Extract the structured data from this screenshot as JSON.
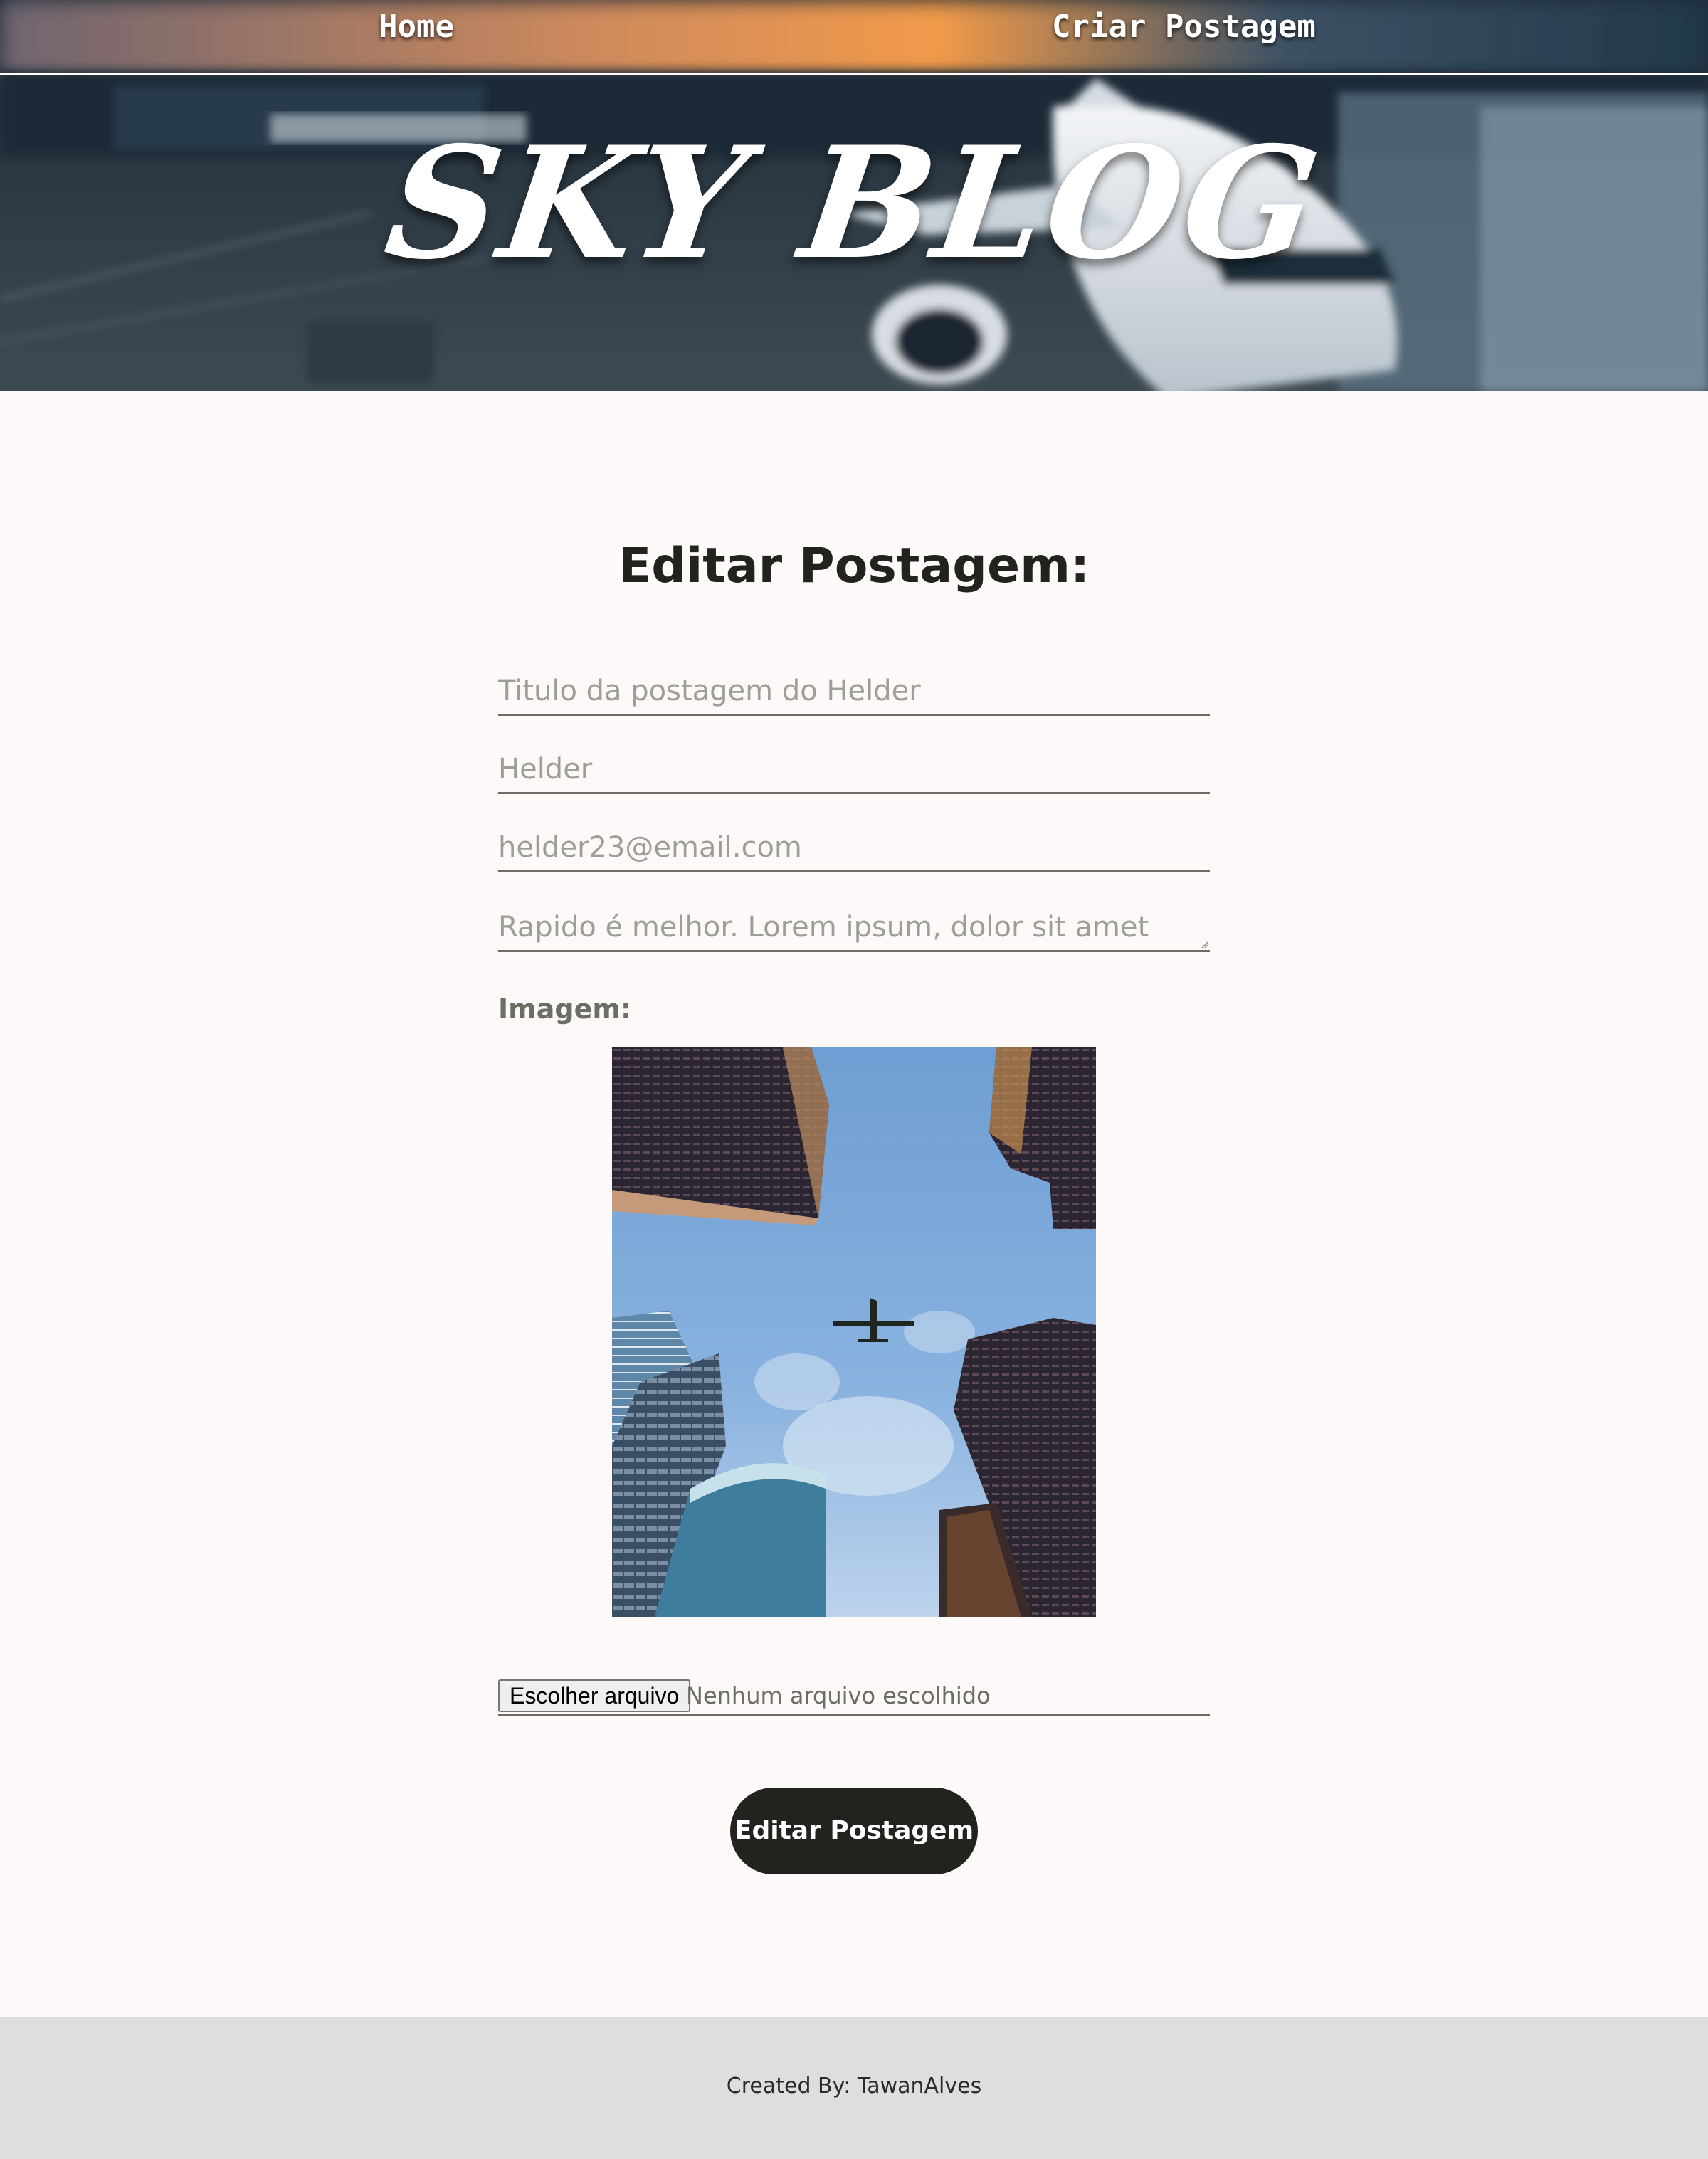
{
  "nav": {
    "home_label": "Home",
    "create_label": "Criar Postagem"
  },
  "brand": {
    "title": "SKY BLOG"
  },
  "main": {
    "page_title": "Editar Postagem:",
    "fields": {
      "title_value": "Titulo da postagem do Helder",
      "author_value": "Helder",
      "email_value": "helder23@email.com",
      "body_value": "Rapido é melhor. Lorem ipsum, dolor sit amet"
    },
    "image_label": "Imagem:",
    "file_input": {
      "button_label": "Escolher arquivo",
      "status": "Nenhum arquivo escolhido"
    },
    "submit_label": "Editar Postagem"
  },
  "footer": {
    "credit": "Created By: TawanAlves"
  },
  "colors": {
    "background": "#fcf9f8",
    "text_dark": "#22221e",
    "field_text": "#9e9e98",
    "label": "#6b6f63",
    "footer_bg": "#dededc",
    "button_bg": "#22221e",
    "button_text": "#ffffff"
  }
}
